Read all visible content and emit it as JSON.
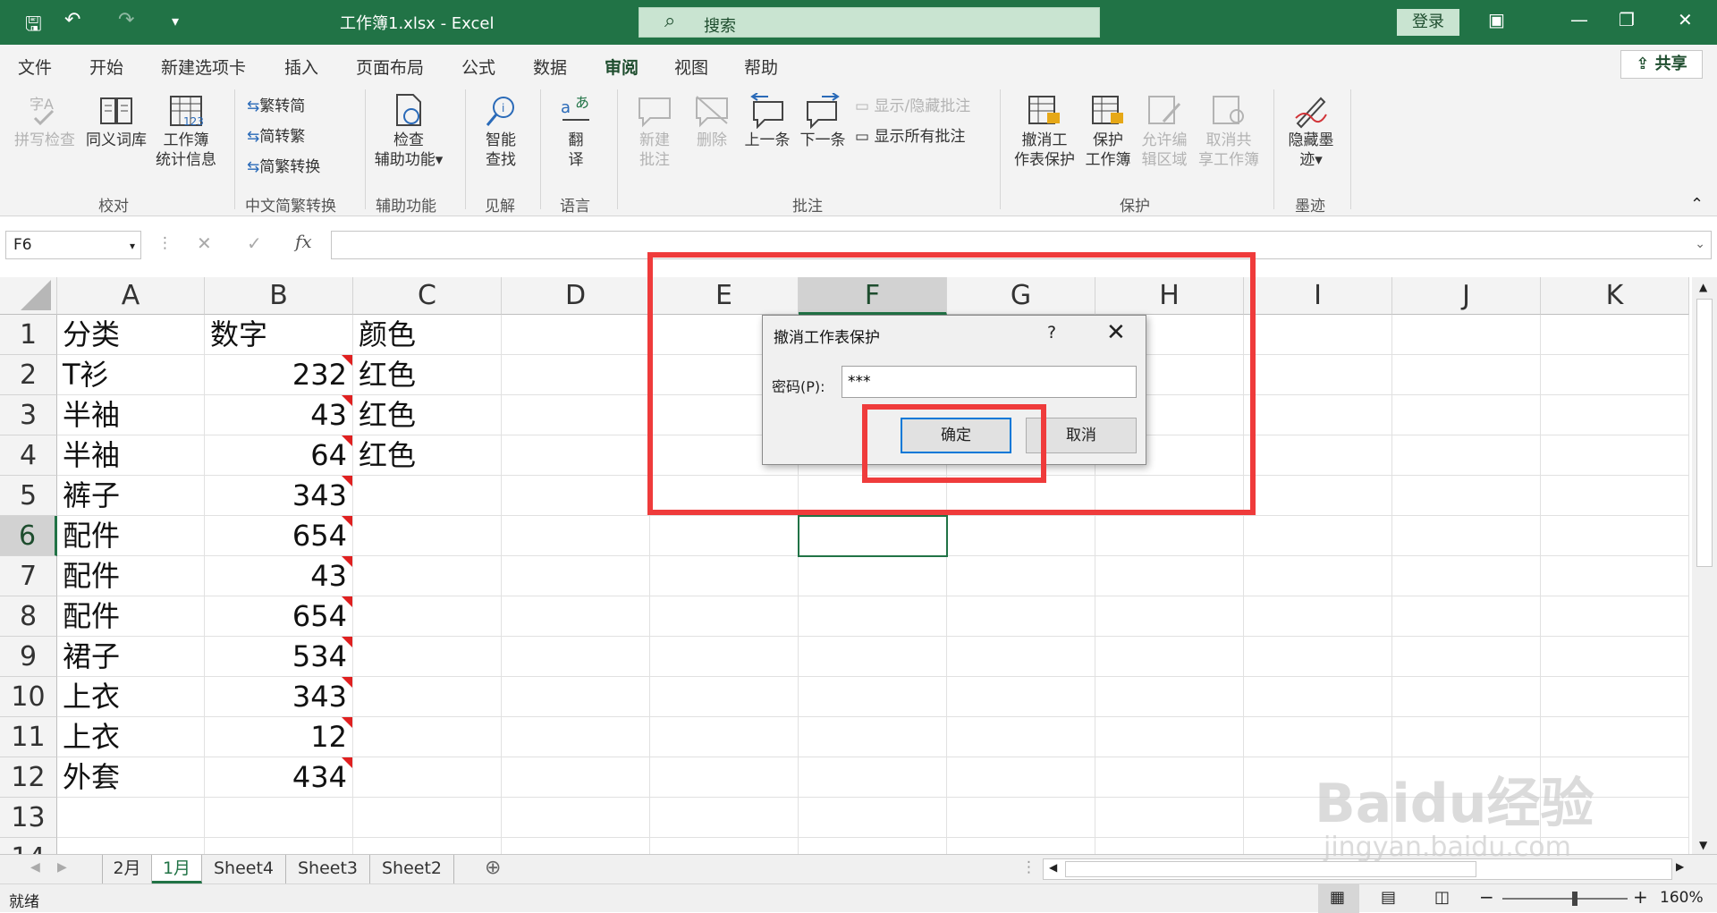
{
  "titlebar": {
    "doc_title": "工作簿1.xlsx  -  Excel",
    "search_placeholder": "搜索",
    "login": "登录"
  },
  "menu": {
    "tabs": [
      "文件",
      "开始",
      "新建选项卡",
      "插入",
      "页面布局",
      "公式",
      "数据",
      "审阅",
      "视图",
      "帮助"
    ],
    "active": "审阅",
    "share": "共享"
  },
  "ribbon": {
    "spelling": "拼写检查",
    "thesaurus": "同义词库",
    "workbook_stats_1": "工作簿",
    "workbook_stats_2": "统计信息",
    "group_proofing": "校对",
    "trad_to_simp": "繁转简",
    "simp_to_trad": "简转繁",
    "convert": "简繁转换",
    "group_chinese": "中文简繁转换",
    "check_access_1": "检查",
    "check_access_2": "辅助功能",
    "group_access": "辅助功能",
    "smart_lookup_1": "智能",
    "smart_lookup_2": "查找",
    "group_insights": "见解",
    "translate_1": "翻",
    "translate_2": "译",
    "group_language": "语言",
    "new_comment_1": "新建",
    "new_comment_2": "批注",
    "delete": "删除",
    "prev": "上一条",
    "next": "下一条",
    "show_hide": "显示/隐藏批注",
    "show_all": "显示所有批注",
    "group_comments": "批注",
    "unprotect_sheet_1": "撤消工",
    "unprotect_sheet_2": "作表保护",
    "protect_wb_1": "保护",
    "protect_wb_2": "工作簿",
    "allow_edit_1": "允许编",
    "allow_edit_2": "辑区域",
    "unshare_1": "取消共",
    "unshare_2": "享工作簿",
    "group_protect": "保护",
    "hide_ink_1": "隐藏墨",
    "hide_ink_2": "迹",
    "group_ink": "墨迹"
  },
  "formula": {
    "namebox": "F6"
  },
  "columns": [
    "A",
    "B",
    "C",
    "D",
    "E",
    "F",
    "G",
    "H",
    "I",
    "J",
    "K"
  ],
  "rows": [
    "1",
    "2",
    "3",
    "4",
    "5",
    "6",
    "7",
    "8",
    "9",
    "10",
    "11",
    "12",
    "13",
    "14"
  ],
  "table": [
    [
      "分类",
      "数字",
      "颜色"
    ],
    [
      "T衫",
      "232",
      "红色"
    ],
    [
      "半袖",
      "43",
      "红色"
    ],
    [
      "半袖",
      "64",
      "红色"
    ],
    [
      "裤子",
      "343",
      ""
    ],
    [
      "配件",
      "654",
      ""
    ],
    [
      "配件",
      "43",
      ""
    ],
    [
      "配件",
      "654",
      ""
    ],
    [
      "裙子",
      "534",
      ""
    ],
    [
      "上衣",
      "343",
      ""
    ],
    [
      "上衣",
      "12",
      ""
    ],
    [
      "外套",
      "434",
      ""
    ]
  ],
  "sheets": [
    "2月",
    "1月",
    "Sheet4",
    "Sheet3",
    "Sheet2"
  ],
  "active_sheet": "1月",
  "status": {
    "ready": "就绪",
    "zoom": "160%"
  },
  "dialog": {
    "title": "撤消工作表保护",
    "help": "?",
    "label": "密码(P):",
    "password": "***",
    "ok": "确定",
    "cancel": "取消"
  },
  "watermark": {
    "brand": "Baidu经验",
    "url": "jingyan.baidu.com"
  }
}
